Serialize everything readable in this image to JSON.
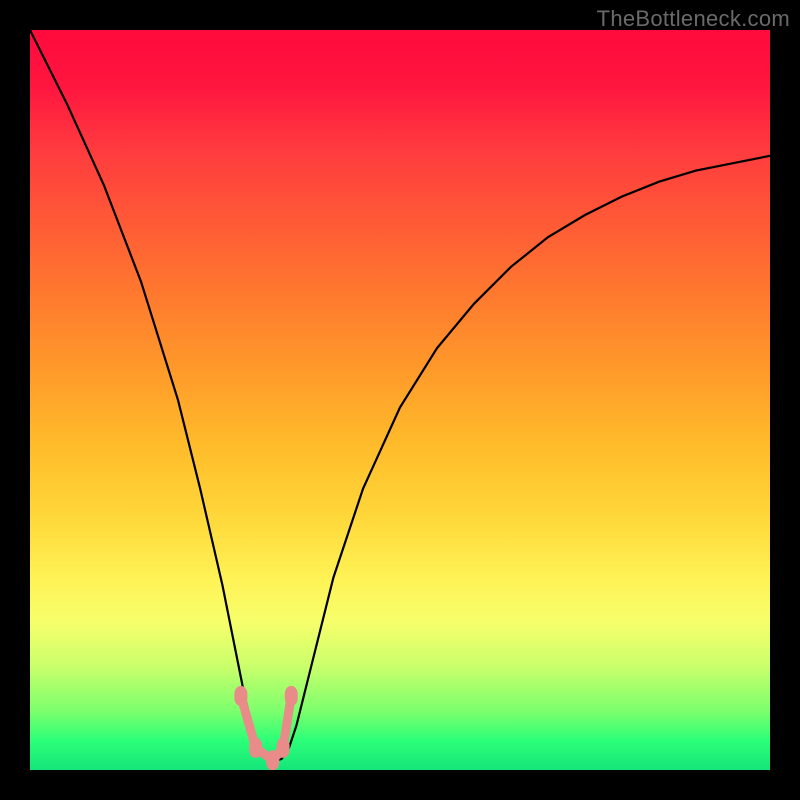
{
  "watermark": "TheBottleneck.com",
  "colors": {
    "page_bg": "#000000",
    "watermark": "#6a6a6a",
    "curve": "#000000",
    "markers": "#e98b88",
    "gradient_stops": [
      "#ff0a3c",
      "#ff173f",
      "#ff3a3f",
      "#ff5a36",
      "#ff7a2e",
      "#ff9a2a",
      "#ffbb2a",
      "#ffd83a",
      "#fff255",
      "#f7ff6b",
      "#c9ff6b",
      "#7dff6d",
      "#2cff78",
      "#14e57a"
    ]
  },
  "chart_data": {
    "type": "line",
    "title": "",
    "xlabel": "",
    "ylabel": "",
    "xlim": [
      0,
      100
    ],
    "ylim": [
      0,
      100
    ],
    "grid": false,
    "legend": false,
    "note": "No axis ticks or labels are rendered in the image; values are estimated from the plot area as 0–100 on each axis. Curve depicts a V-shaped function with minimum near x≈32; color gradient maps y (high=red, low=green).",
    "series": [
      {
        "name": "curve",
        "x": [
          0,
          5,
          10,
          15,
          20,
          23,
          26,
          28,
          29,
          30,
          31,
          32,
          33,
          34,
          35,
          36,
          38,
          41,
          45,
          50,
          55,
          60,
          65,
          70,
          75,
          80,
          85,
          90,
          95,
          100
        ],
        "y": [
          100,
          90,
          79,
          66,
          50,
          38,
          25,
          15,
          10,
          6,
          3,
          1.5,
          1.2,
          1.5,
          3,
          6,
          14,
          26,
          38,
          49,
          57,
          63,
          68,
          72,
          75,
          77.5,
          79.5,
          81,
          82,
          83
        ]
      }
    ],
    "markers": [
      {
        "name": "left-knee",
        "x": 28.5,
        "y": 10
      },
      {
        "name": "bottom-left",
        "x": 30.5,
        "y": 3
      },
      {
        "name": "bottom-mid",
        "x": 32.8,
        "y": 1.3
      },
      {
        "name": "bottom-right",
        "x": 34.2,
        "y": 3
      },
      {
        "name": "right-knee",
        "x": 35.3,
        "y": 10
      }
    ]
  }
}
